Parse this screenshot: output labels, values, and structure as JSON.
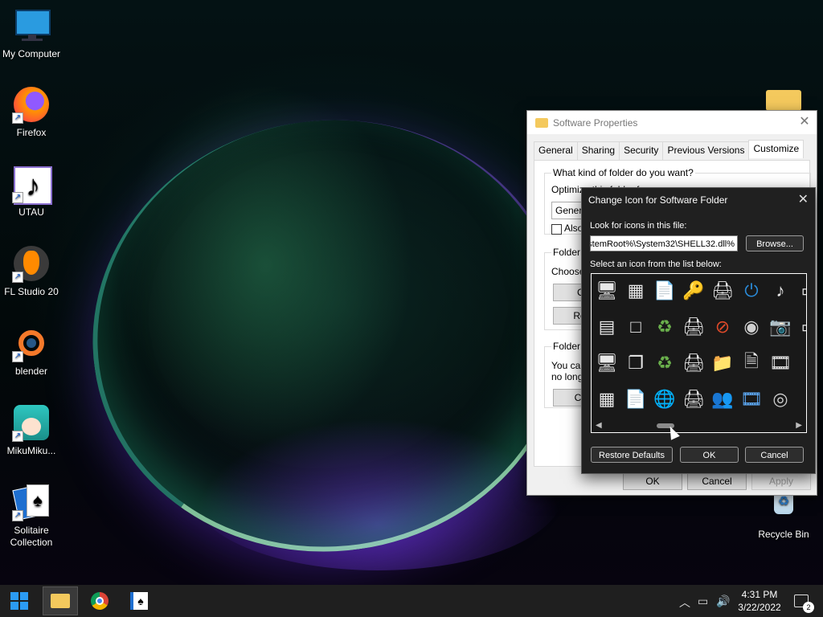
{
  "desktop": {
    "icons": [
      {
        "label": "My Computer",
        "icon": "monitor-icon"
      },
      {
        "label": "Firefox",
        "icon": "firefox-icon"
      },
      {
        "label": "UTAU",
        "icon": "music-note-icon"
      },
      {
        "label": "FL Studio 20",
        "icon": "fl-studio-icon"
      },
      {
        "label": "blender",
        "icon": "blender-icon"
      },
      {
        "label": "MikuMiku...",
        "icon": "miku-icon"
      },
      {
        "label": "Solitaire",
        "label2": "Collection",
        "icon": "cards-icon"
      },
      {
        "label": "Recycle Bin",
        "icon": "recycle-bin-icon"
      }
    ]
  },
  "properties": {
    "title": "Software Properties",
    "tabs": [
      "General",
      "Sharing",
      "Security",
      "Previous Versions",
      "Customize"
    ],
    "active_tab": "Customize",
    "question": "What kind of folder do you want?",
    "optimize_label": "Optimize this folder for:",
    "optimize_value": "Genera",
    "also_apply": "Also",
    "folder_pictures_caption": "Folder p",
    "choose_text": "Choose",
    "choose_btn": "Cho",
    "restore_btn": "Resto",
    "folder_icons_caption": "Folder ic",
    "folder_icons_text1": "You can",
    "folder_icons_text2": "no longe",
    "change_btn": "Chan",
    "ok": "OK",
    "cancel": "Cancel",
    "apply": "Apply"
  },
  "change_icon": {
    "title": "Change Icon for Software Folder",
    "look_label": "Look for icons in this file:",
    "file_value": "%SystemRoot%\\System32\\SHELL32.dll",
    "browse": "Browse...",
    "select_label": "Select an icon from the list below:",
    "icons": [
      "computer-network-icon",
      "control-panel-icon",
      "shortcut-doc-icon",
      "keys-icon",
      "printer-icon",
      "power-icon",
      "audio-file-icon",
      "drive-icon",
      "desktop-window-icon",
      "blank-window-icon",
      "recycle-full-icon",
      "fax-icon",
      "prohibited-icon",
      "dvd-icon",
      "camera-icon",
      "drive-icon",
      "monitor-window-icon",
      "windows-cascade-icon",
      "recycle-empty-icon",
      "printer-check-icon",
      "folder-check-icon",
      "documents-icon",
      "media-file-icon",
      "arrow-icon",
      "control-list-icon",
      "doc-hand-icon",
      "globe-monitor-icon",
      "printer-shared-icon",
      "users-key-icon",
      "film-icon",
      "cd-icon",
      ""
    ],
    "restore_defaults": "Restore Defaults",
    "ok": "OK",
    "cancel": "Cancel"
  },
  "taskbar": {
    "time": "4:31 PM",
    "date": "3/22/2022",
    "notifications": "2"
  }
}
